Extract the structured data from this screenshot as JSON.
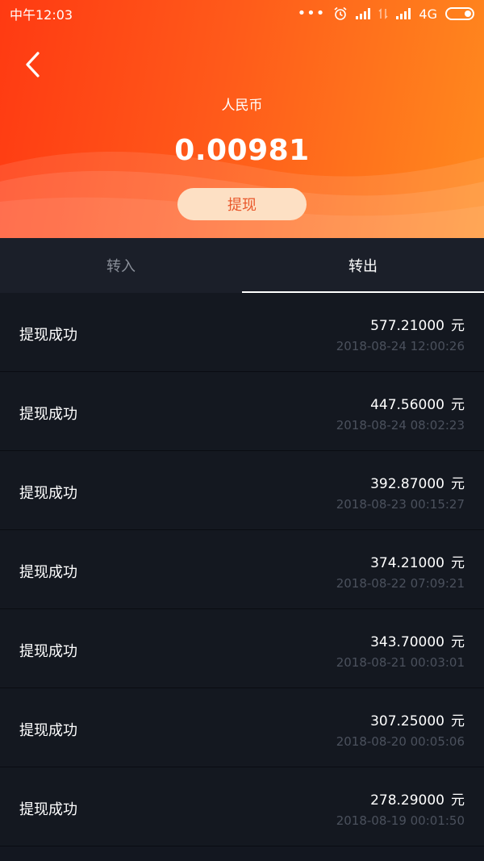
{
  "status_bar": {
    "time": "中午12:03",
    "network": "4G",
    "icons": [
      "more-dots-icon",
      "alarm-icon",
      "signal-icon",
      "data-arrows-icon",
      "signal-icon",
      "battery-icon"
    ]
  },
  "header": {
    "back_icon": "chevron-left-icon",
    "currency_label": "人民币",
    "balance": "0.00981",
    "withdraw_label": "提现",
    "gradient_colors": [
      "#ff3a12",
      "#ff8a1e"
    ]
  },
  "tabs": [
    {
      "label": "转入",
      "active": false
    },
    {
      "label": "转出",
      "active": true
    }
  ],
  "records": [
    {
      "title": "提现成功",
      "amount": "577.21000",
      "unit": "元",
      "time": "2018-08-24 12:00:26"
    },
    {
      "title": "提现成功",
      "amount": "447.56000",
      "unit": "元",
      "time": "2018-08-24 08:02:23"
    },
    {
      "title": "提现成功",
      "amount": "392.87000",
      "unit": "元",
      "time": "2018-08-23 00:15:27"
    },
    {
      "title": "提现成功",
      "amount": "374.21000",
      "unit": "元",
      "time": "2018-08-22 07:09:21"
    },
    {
      "title": "提现成功",
      "amount": "343.70000",
      "unit": "元",
      "time": "2018-08-21 00:03:01"
    },
    {
      "title": "提现成功",
      "amount": "307.25000",
      "unit": "元",
      "time": "2018-08-20 00:05:06"
    },
    {
      "title": "提现成功",
      "amount": "278.29000",
      "unit": "元",
      "time": "2018-08-19 00:01:50"
    }
  ]
}
